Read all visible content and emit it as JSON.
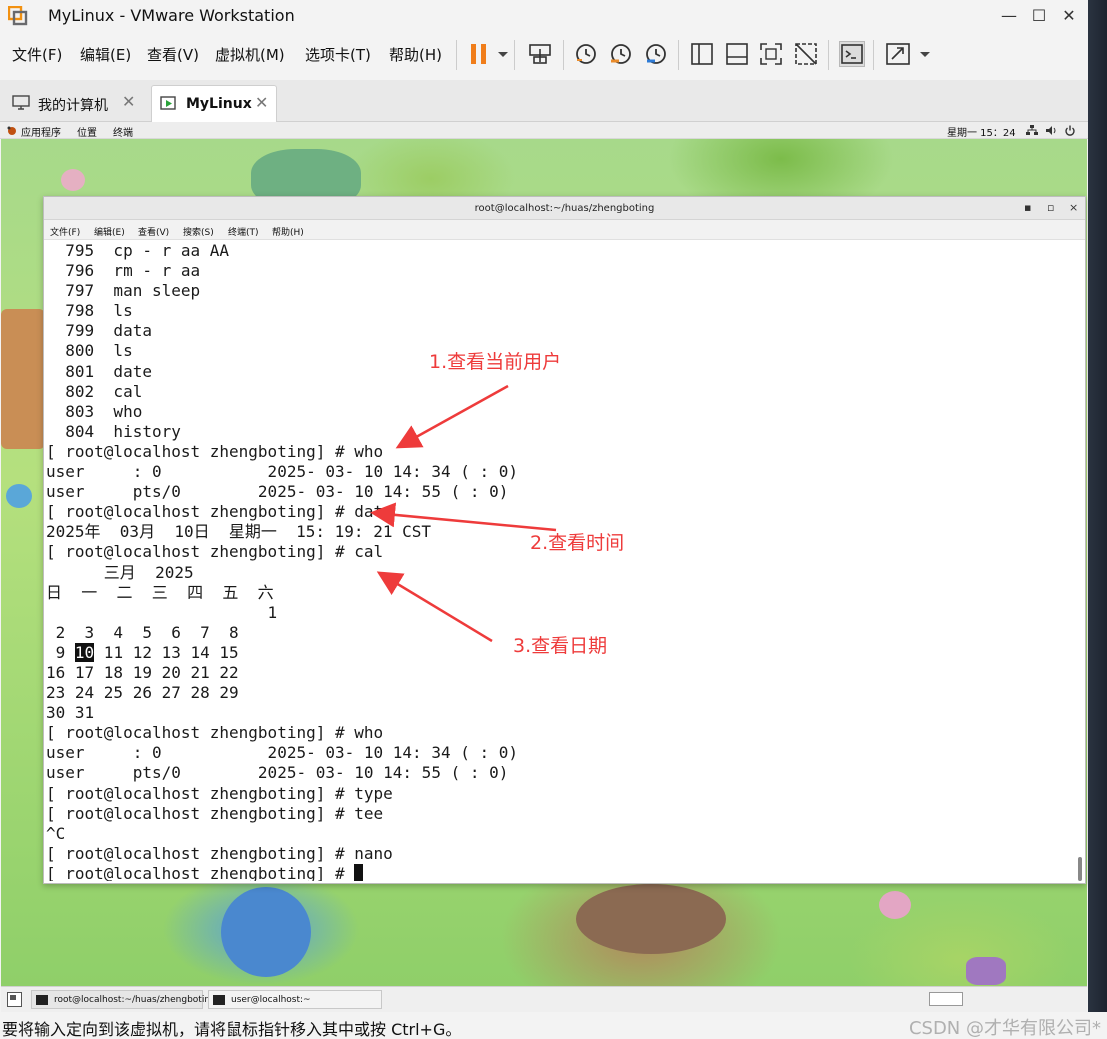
{
  "window": {
    "title": "MyLinux - VMware Workstation",
    "minimize_glyph": "—",
    "maximize_glyph": "☐",
    "close_glyph": "✕"
  },
  "menu": {
    "items": [
      {
        "label": "文件(F)"
      },
      {
        "label": "编辑(E)"
      },
      {
        "label": "查看(V)"
      },
      {
        "label": "虚拟机(M)"
      },
      {
        "label": "选项卡(T)"
      },
      {
        "label": "帮助(H)"
      }
    ]
  },
  "toolbar": {
    "icons": [
      "pause-icon",
      "dropdown-icon",
      "send-ctrl-alt-del-icon",
      "snapshot-icon",
      "revert-snapshot-icon",
      "snapshot-manager-icon",
      "library-icon",
      "thumbnail-icon",
      "fullscreen-icon",
      "unity-icon",
      "console-icon",
      "stretch-icon"
    ]
  },
  "tabs": [
    {
      "label": "我的计算机",
      "icon": "computer-icon",
      "close": "✕"
    },
    {
      "label": "MyLinux",
      "icon": "vm-icon",
      "close": "✕"
    }
  ],
  "gnome_bar": {
    "applications": "应用程序",
    "places": "位置",
    "terminal": "终端",
    "clock": "星期一 15：24",
    "network_icon": "network-icon",
    "volume_icon": "volume-icon",
    "power_icon": "power-icon"
  },
  "terminal": {
    "title": "root@localhost:~/huas/zhengboting",
    "minimize": "▪",
    "maximize": "▫",
    "close": "×",
    "menu": [
      "文件(F)",
      "编辑(E)",
      "查看(V)",
      "搜索(S)",
      "终端(T)",
      "帮助(H)"
    ],
    "lines": [
      "  795  cp - r aa AA",
      "  796  rm - r aa",
      "  797  man sleep",
      "  798  ls",
      "  799  data",
      "  800  ls",
      "  801  date",
      "  802  cal",
      "  803  who",
      "  804  history",
      "[ root@localhost zhengboting] # who",
      "user     : 0           2025- 03- 10 14: 34 ( : 0)",
      "user     pts/0        2025- 03- 10 14: 55 ( : 0)",
      "[ root@localhost zhengboting] # date",
      "2025年  03月  10日  星期一  15: 19: 21 CST",
      "[ root@localhost zhengboting] # cal",
      "      三月  2025",
      "日  一  二  三  四  五  六",
      "                       1",
      " 2  3  4  5  6  7  8",
      null,
      "16 17 18 19 20 21 22",
      "23 24 25 26 27 28 29",
      "30 31",
      "[ root@localhost zhengboting] # who",
      "user     : 0           2025- 03- 10 14: 34 ( : 0)",
      "user     pts/0        2025- 03- 10 14: 55 ( : 0)",
      "[ root@localhost zhengboting] # type",
      "[ root@localhost zhengboting] # tee",
      "^C",
      "[ root@localhost zhengboting] # nano",
      "[ root@localhost zhengboting] # "
    ],
    "cal_row_before": " 9 ",
    "cal_today": "10",
    "cal_row_after": " 11 12 13 14 15"
  },
  "annotations": [
    {
      "text": "1.查看当前用户"
    },
    {
      "text": "2.查看时间"
    },
    {
      "text": "3.查看日期"
    }
  ],
  "annotation_color": "#ee3b3b",
  "taskbar": {
    "items": [
      {
        "label": "root@localhost:~/huas/zhengboting"
      },
      {
        "label": "user@localhost:~"
      }
    ]
  },
  "statusbar": {
    "message": "要将输入定向到该虚拟机，请将鼠标指针移入其中或按 Ctrl+G。",
    "watermark": "CSDN @才华有限公司*"
  }
}
